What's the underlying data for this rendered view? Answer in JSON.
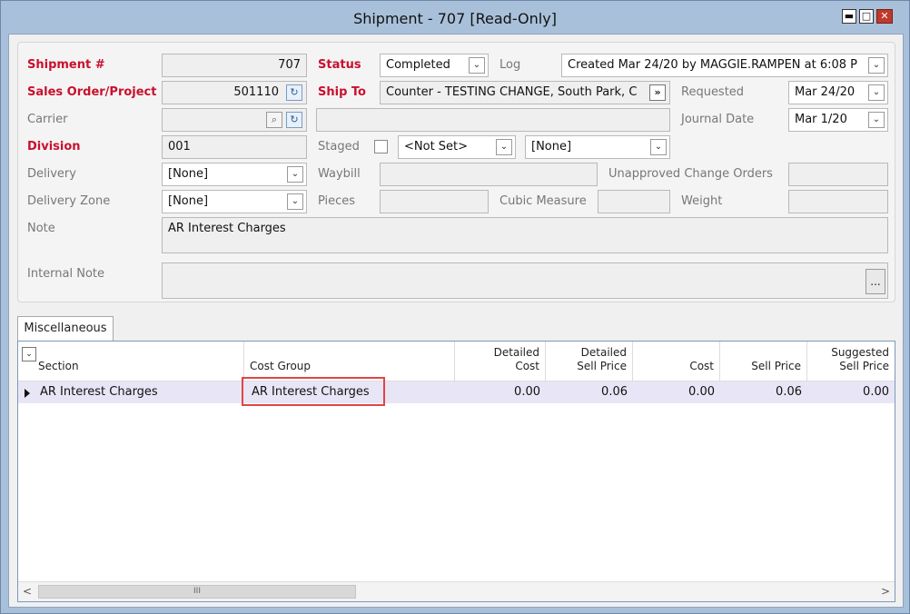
{
  "window": {
    "title": "Shipment - 707 [Read-Only]",
    "min_glyph": "▬",
    "max_glyph": "□",
    "close_glyph": "✕"
  },
  "form": {
    "shipment_label": "Shipment #",
    "shipment_value": "707",
    "sales_order_label": "Sales Order/Project",
    "sales_order_value": "501110",
    "carrier_label": "Carrier",
    "carrier_value": "",
    "division_label": "Division",
    "division_value": "001",
    "delivery_label": "Delivery",
    "delivery_value": "[None]",
    "delivery_zone_label": "Delivery Zone",
    "delivery_zone_value": "[None]",
    "note_label": "Note",
    "note_value": "AR Interest Charges",
    "internal_note_label": "Internal Note",
    "internal_note_value": "",
    "status_label": "Status",
    "status_value": "Completed",
    "log_label": "Log",
    "log_value": "Created Mar 24/20 by MAGGIE.RAMPEN at 6:08 P",
    "ship_to_label": "Ship To",
    "ship_to_value": "Counter - TESTING CHANGE, South Park, C",
    "ship_to_extra": "",
    "staged_label": "Staged",
    "staged_select_1": "<Not Set>",
    "staged_select_2": "[None]",
    "waybill_label": "Waybill",
    "waybill_value": "",
    "pieces_label": "Pieces",
    "pieces_value": "",
    "cubic_measure_label": "Cubic Measure",
    "cubic_measure_value": "",
    "requested_label": "Requested",
    "requested_value": "Mar 24/20",
    "journal_date_label": "Journal Date",
    "journal_date_value": "Mar 1/20",
    "unapproved_label": "Unapproved Change Orders",
    "unapproved_value": "",
    "weight_label": "Weight",
    "weight_value": "",
    "ellipsis": "..."
  },
  "tabs": [
    {
      "label": "Miscellaneous"
    }
  ],
  "grid": {
    "columns": [
      {
        "label": "Section"
      },
      {
        "label": "Cost Group"
      },
      {
        "label": "Detailed\nCost"
      },
      {
        "label": "Detailed\nSell Price"
      },
      {
        "label": "Cost"
      },
      {
        "label": "Sell Price"
      },
      {
        "label": "Suggested\nSell Price"
      }
    ],
    "rows": [
      {
        "section": "AR Interest Charges",
        "cost_group": "AR Interest Charges",
        "detailed_cost": "0.00",
        "detailed_sell_price": "0.06",
        "cost": "0.00",
        "sell_price": "0.06",
        "suggested_sell_price": "0.00"
      }
    ],
    "scroll_left": "<",
    "scroll_right": ">",
    "scroll_thumb": "III"
  }
}
